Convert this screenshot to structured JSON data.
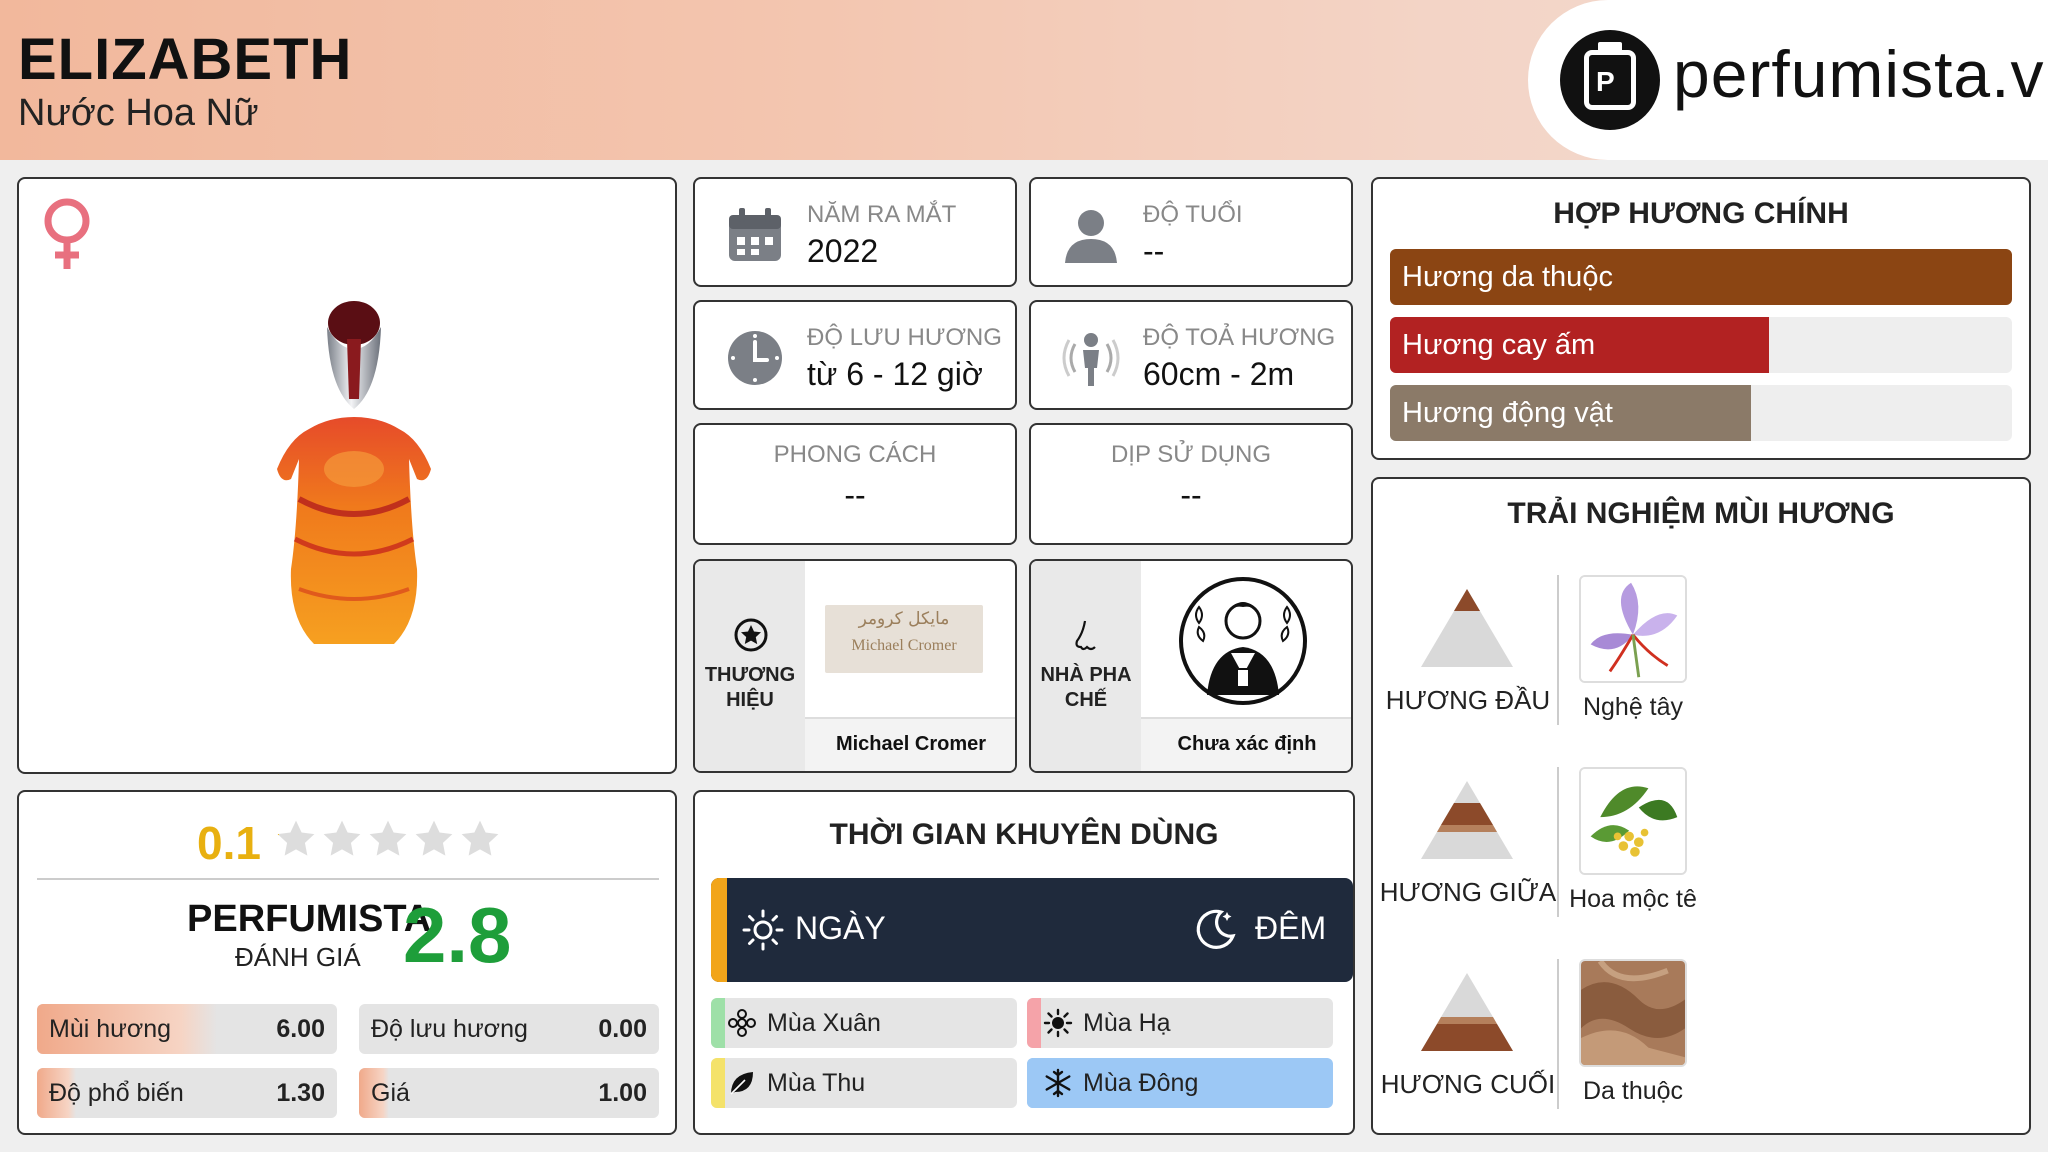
{
  "header": {
    "title": "ELIZABETH",
    "subtitle": "Nước Hoa Nữ",
    "logo_text": "perfumista.vn"
  },
  "icons": {
    "gender": "female-icon",
    "release": "calendar-icon",
    "age": "user-icon",
    "longevity": "clock-icon",
    "sillage": "radiating-person-icon",
    "brand": "star-badge-icon",
    "perfumer": "nose-icon",
    "day": "sun-icon",
    "night": "moon-icon"
  },
  "colors": {
    "female": "#e8707f",
    "rating_gold": "#e8b010",
    "score_green": "#1e9e3a",
    "night_bg": "#1f2a3c",
    "day_accent": "#f2a51a"
  },
  "rating": {
    "user_score": "0.1",
    "stars_filled": 0.02,
    "perfumista_label": "PERFUMISTA",
    "perfumista_sub": "ĐÁNH GIÁ",
    "perfumista_score": "2.8",
    "metrics": [
      {
        "label": "Mùi hương",
        "value": "6.00",
        "fill": 0.6
      },
      {
        "label": "Độ lưu hương",
        "value": "0.00",
        "fill": 0.0
      },
      {
        "label": "Độ phổ biến",
        "value": "1.30",
        "fill": 0.13
      },
      {
        "label": "Giá",
        "value": "1.00",
        "fill": 0.1
      }
    ]
  },
  "info": {
    "release": {
      "label": "NĂM RA MẮT",
      "value": "2022"
    },
    "age": {
      "label": "ĐỘ TUỔI",
      "value": "--"
    },
    "longevity": {
      "label": "ĐỘ LƯU HƯƠNG",
      "value": "từ 6 - 12 giờ"
    },
    "sillage": {
      "label": "ĐỘ TOẢ HƯƠNG",
      "value": "60cm - 2m"
    },
    "style": {
      "label": "PHONG CÁCH",
      "value": "--"
    },
    "occasion": {
      "label": "DỊP SỬ DỤNG",
      "value": "--"
    }
  },
  "brand": {
    "label": "THƯƠNG HIỆU",
    "name": "Michael Cromer",
    "logo_ar": "مايكل كرومر",
    "logo_en": "Michael Cromer"
  },
  "perfumer": {
    "label": "NHÀ PHA CHẾ",
    "name": "Chưa xác định"
  },
  "time": {
    "title": "THỜI GIAN KHUYÊN DÙNG",
    "day": "NGÀY",
    "night": "ĐÊM",
    "day_fill": 0.02,
    "seasons": [
      {
        "label": "Mùa Xuân",
        "color": "#9ee0a8",
        "icon": "flower-icon"
      },
      {
        "label": "Mùa Hạ",
        "color": "#f5a3a9",
        "icon": "sun-icon"
      },
      {
        "label": "Mùa Thu",
        "color": "#f4e26a",
        "icon": "leaf-icon"
      },
      {
        "label": "Mùa Đông",
        "color": "#9cc8f5",
        "icon": "snowflake-icon"
      }
    ]
  },
  "accords": {
    "title": "HỢP HƯƠNG CHÍNH",
    "items": [
      {
        "label": "Hương da thuộc",
        "fill": 1.0,
        "color": "#8b4513"
      },
      {
        "label": "Hương cay ấm",
        "fill": 0.61,
        "color": "#b22222"
      },
      {
        "label": "Hương động vật",
        "fill": 0.58,
        "color": "#8b7a68"
      }
    ]
  },
  "experience": {
    "title": "TRẢI NGHIỆM MÙI HƯƠNG",
    "notes": [
      {
        "stage": "HƯƠNG ĐẦU",
        "note": "Nghệ tây"
      },
      {
        "stage": "HƯƠNG GIỮA",
        "note": "Hoa mộc tê"
      },
      {
        "stage": "HƯƠNG CUỐI",
        "note": "Da thuộc"
      }
    ]
  }
}
